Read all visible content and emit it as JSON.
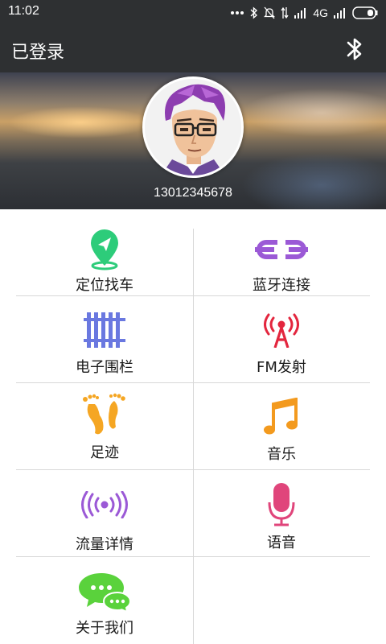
{
  "status_bar": {
    "time": "11:02",
    "network": "4G"
  },
  "title_bar": {
    "title": "已登录"
  },
  "profile": {
    "phone": "13012345678"
  },
  "menu": {
    "items": [
      {
        "label": "定位找车",
        "icon": "location-pin-icon",
        "color": "#2dcc7a"
      },
      {
        "label": "蓝牙连接",
        "icon": "link-chain-icon",
        "color": "#9b59d6"
      },
      {
        "label": "电子围栏",
        "icon": "fence-icon",
        "color": "#6a78e0"
      },
      {
        "label": "FM发射",
        "icon": "antenna-icon",
        "color": "#e3263e"
      },
      {
        "label": "足迹",
        "icon": "footprints-icon",
        "color": "#f5a623"
      },
      {
        "label": "音乐",
        "icon": "music-note-icon",
        "color": "#f39a1e"
      },
      {
        "label": "流量详情",
        "icon": "signal-waves-icon",
        "color": "#9b59d6"
      },
      {
        "label": "语音",
        "icon": "microphone-icon",
        "color": "#e0457b"
      },
      {
        "label": "关于我们",
        "icon": "chat-bubbles-icon",
        "color": "#5ad23c"
      }
    ]
  }
}
